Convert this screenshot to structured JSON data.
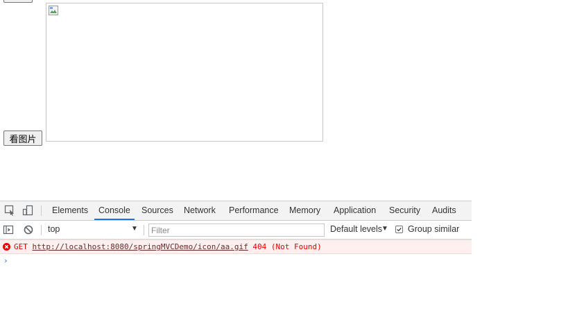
{
  "page": {
    "view_button_label": "看图片"
  },
  "devtools": {
    "tabs": [
      "Elements",
      "Console",
      "Sources",
      "Network",
      "Performance",
      "Memory",
      "Application",
      "Security",
      "Audits"
    ],
    "active_tab": "Console",
    "toolbar": {
      "context": "top",
      "filter_placeholder": "Filter",
      "levels_label": "Default levels",
      "group_similar_label": "Group similar",
      "group_similar_checked": true
    },
    "console": {
      "error": {
        "method": "GET",
        "url": "http://localhost:8080/springMVCDemo/icon/aa.gif",
        "status": "404 (Not Found)"
      }
    }
  },
  "colors": {
    "error_text": "#e60000",
    "error_bg": "#fff0f0",
    "accent": "#1a73e8"
  }
}
